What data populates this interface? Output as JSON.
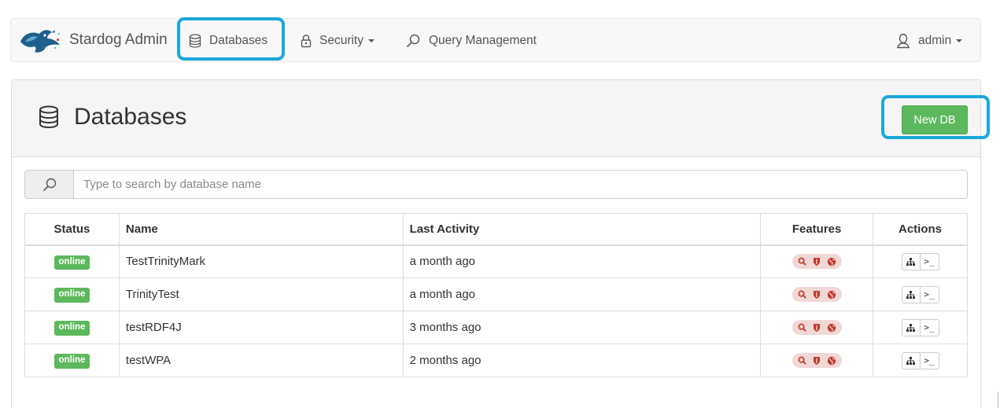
{
  "navbar": {
    "brand": "Stardog Admin",
    "items": [
      {
        "label": "Databases",
        "icon": "database-icon"
      },
      {
        "label": "Security",
        "icon": "lock-icon",
        "dropdown": true
      },
      {
        "label": "Query Management",
        "icon": "search-icon"
      }
    ],
    "user": {
      "label": "admin",
      "icon": "user-icon",
      "dropdown": true
    }
  },
  "page": {
    "title": "Databases",
    "new_db_label": "New DB"
  },
  "search": {
    "placeholder": "Type to search by database name"
  },
  "table": {
    "columns": [
      "Status",
      "Name",
      "Last Activity",
      "Features",
      "Actions"
    ],
    "rows": [
      {
        "status": "online",
        "name": "TestTrinityMark",
        "last_activity": "a month ago"
      },
      {
        "status": "online",
        "name": "TrinityTest",
        "last_activity": "a month ago"
      },
      {
        "status": "online",
        "name": "testRDF4J",
        "last_activity": "3 months ago"
      },
      {
        "status": "online",
        "name": "testWPA",
        "last_activity": "2 months ago"
      }
    ],
    "feature_icons": [
      "search-icon",
      "shield-icon",
      "globe-icon"
    ],
    "action_icons": [
      "sitemap-icon",
      "terminal-icon"
    ],
    "terminal_glyph": ">_"
  },
  "colors": {
    "accent_highlight": "#1aa8dd",
    "success": "#5cb85c",
    "feature_icon": "#c0392b",
    "feature_bg": "#f2d7d7"
  }
}
